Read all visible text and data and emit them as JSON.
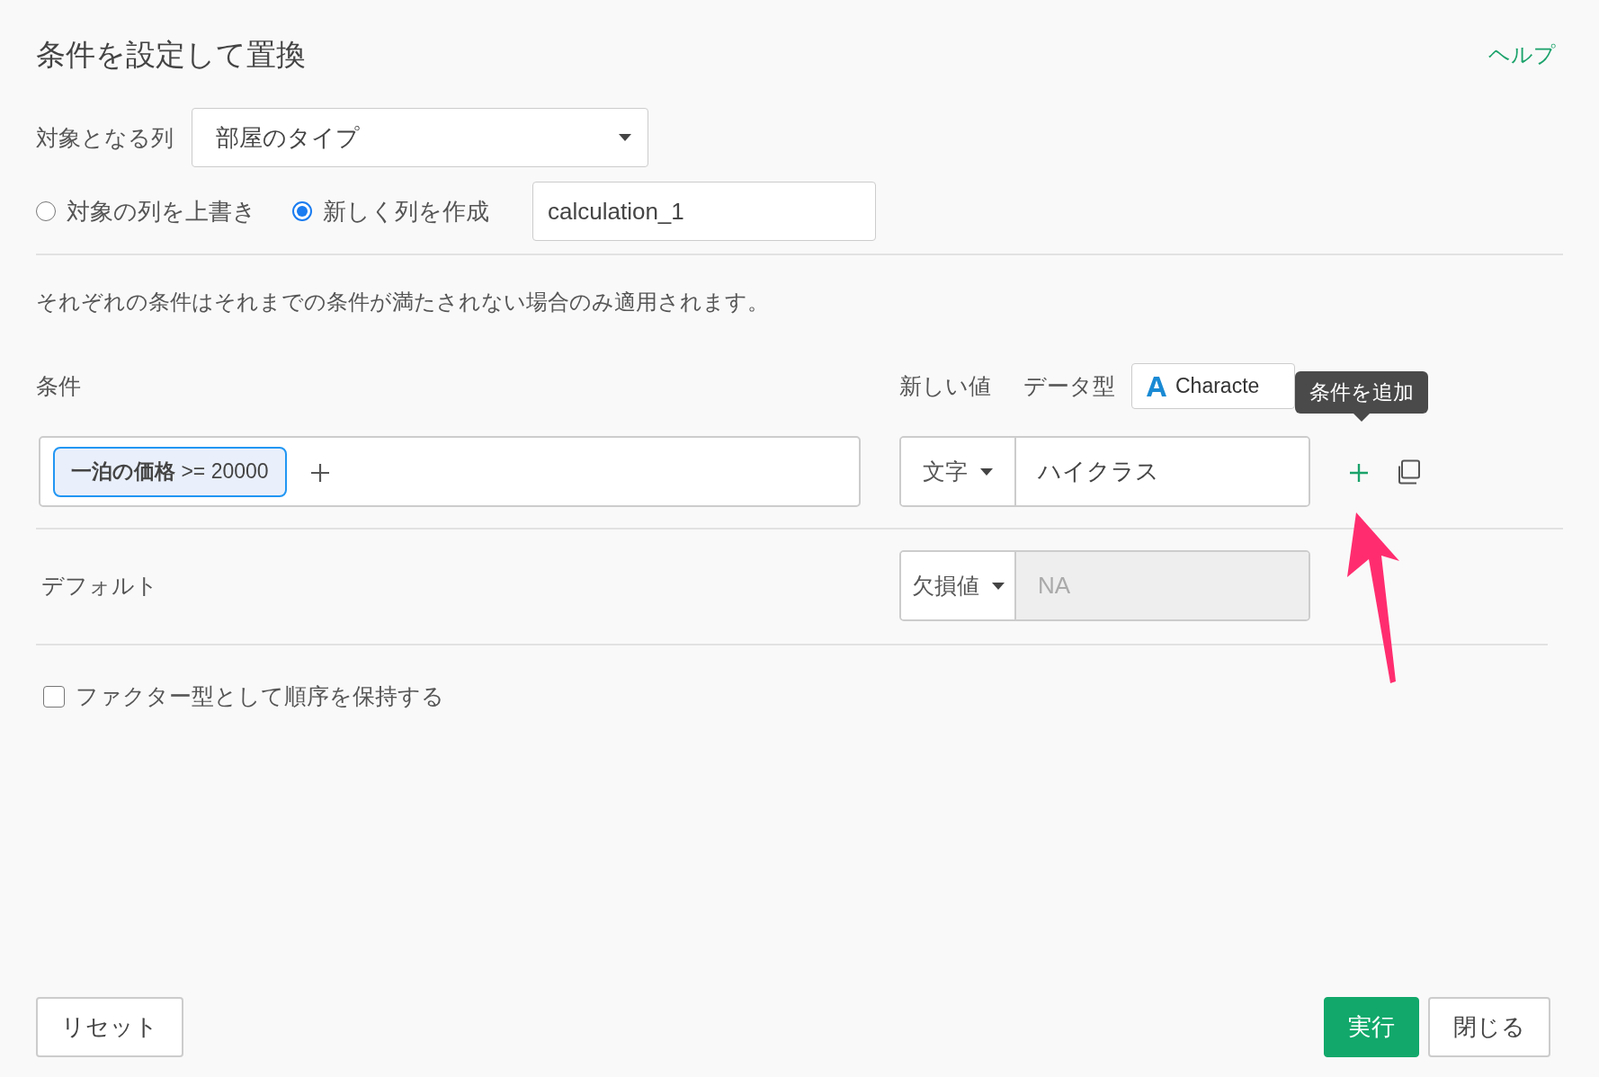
{
  "dialog": {
    "title": "条件を設定して置換",
    "help_link": "ヘルプ"
  },
  "target_column": {
    "label": "対象となる列",
    "value": "部屋のタイプ"
  },
  "mode_options": [
    {
      "label": "対象の列を上書き",
      "selected": false
    },
    {
      "label": "新しく列を作成",
      "selected": true
    }
  ],
  "new_column_name": {
    "value": "calculation_1"
  },
  "description": "それぞれの条件はそれまでの条件が満たされない場合のみ適用されます。",
  "conditions_header": {
    "condition_label": "条件",
    "new_value_label": "新しい値",
    "data_type_label": "データ型",
    "data_type": "Characte"
  },
  "conditions": [
    {
      "condition": "**一泊の価格** >= 20000",
      "value_type": "文字",
      "value": "ハイクラス"
    }
  ],
  "tooltip": "条件を追加",
  "default": {
    "label": "デフォルト",
    "value_type": "欠損値",
    "placeholder": "NA",
    "disabled": true
  },
  "keep_factor_order": {
    "label": "ファクター型として順序を保持する",
    "checked": false
  },
  "buttons": [
    {
      "label": "リセット",
      "kind": "default"
    },
    {
      "label": "実行",
      "kind": "primary"
    },
    {
      "label": "閉じる",
      "kind": "default"
    }
  ]
}
